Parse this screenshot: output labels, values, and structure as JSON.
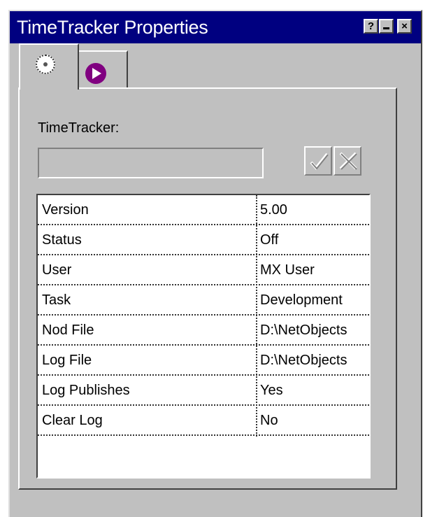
{
  "window": {
    "title": "TimeTracker Properties",
    "help_label": "?",
    "close_label": "×"
  },
  "tabs": [
    {
      "icon": "disc-icon",
      "selected": true
    },
    {
      "icon": "play-icon",
      "selected": false
    }
  ],
  "form": {
    "field_label": "TimeTracker:",
    "field_value": ""
  },
  "properties": [
    {
      "name": "Version",
      "value": "5.00"
    },
    {
      "name": "Status",
      "value": "Off"
    },
    {
      "name": "User",
      "value": "MX User"
    },
    {
      "name": "Task",
      "value": "Development"
    },
    {
      "name": "Nod File",
      "value": "D:\\NetObjects"
    },
    {
      "name": "Log File",
      "value": "D:\\NetObjects"
    },
    {
      "name": "Log Publishes",
      "value": "Yes"
    },
    {
      "name": "Clear Log",
      "value": "No"
    }
  ],
  "colors": {
    "titlebar": "#000080",
    "face": "#c0c0c0",
    "play_icon": "#800080"
  }
}
